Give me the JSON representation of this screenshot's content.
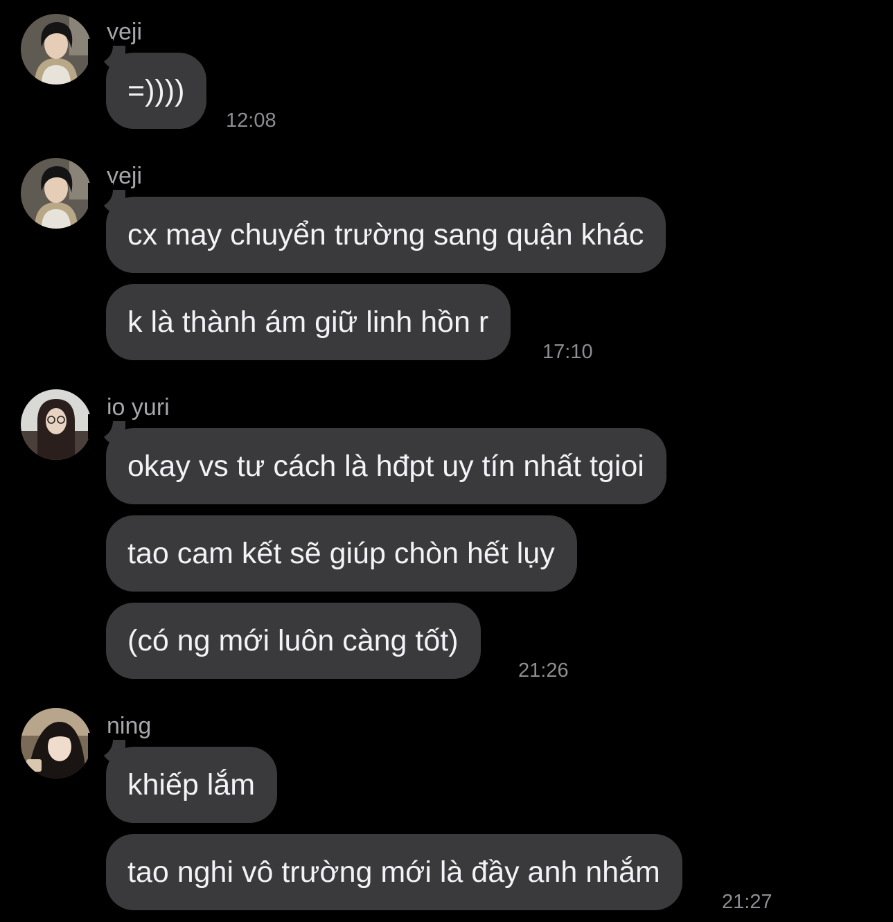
{
  "messages": [
    {
      "sender": "yeji",
      "avatar": "yeji-avatar",
      "bubbles": [
        "=))))"
      ],
      "time": "12:08"
    },
    {
      "sender": "yeji",
      "avatar": "yeji-avatar",
      "bubbles": [
        "cx may chuyển trường sang quận khác",
        "k là thành ám giữ linh hồn r"
      ],
      "time": "17:10"
    },
    {
      "sender": "jo yuri",
      "avatar": "jo-yuri-avatar",
      "bubbles": [
        "okay vs tư cách là hđpt uy tín nhất tgioi",
        "tao cam kết sẽ giúp chòn hết lụy",
        "(có ng mới luôn càng tốt)"
      ],
      "time": "21:26"
    },
    {
      "sender": "ning",
      "avatar": "ning-avatar",
      "bubbles": [
        "khiếp lắm",
        "tao nghi vô trường mới là đầy anh nhắm"
      ],
      "time": "21:27"
    }
  ],
  "colors": {
    "background": "#000000",
    "bubble": "#3a3a3c",
    "bubble_text": "#f2f2f7",
    "sender_text": "#a7a7ab",
    "time_text": "#8e8e93"
  }
}
